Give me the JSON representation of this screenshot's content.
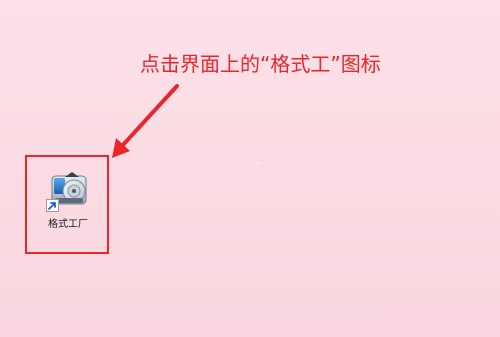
{
  "annotation": {
    "instruction_text": "点击界面上的“格式工”图标",
    "color": "#e8262b"
  },
  "desktop": {
    "background_color": "#fbdce4",
    "icons": [
      {
        "label": "格式工厂",
        "icon": "format-factory-app-icon",
        "has_shortcut_overlay": true
      }
    ]
  }
}
